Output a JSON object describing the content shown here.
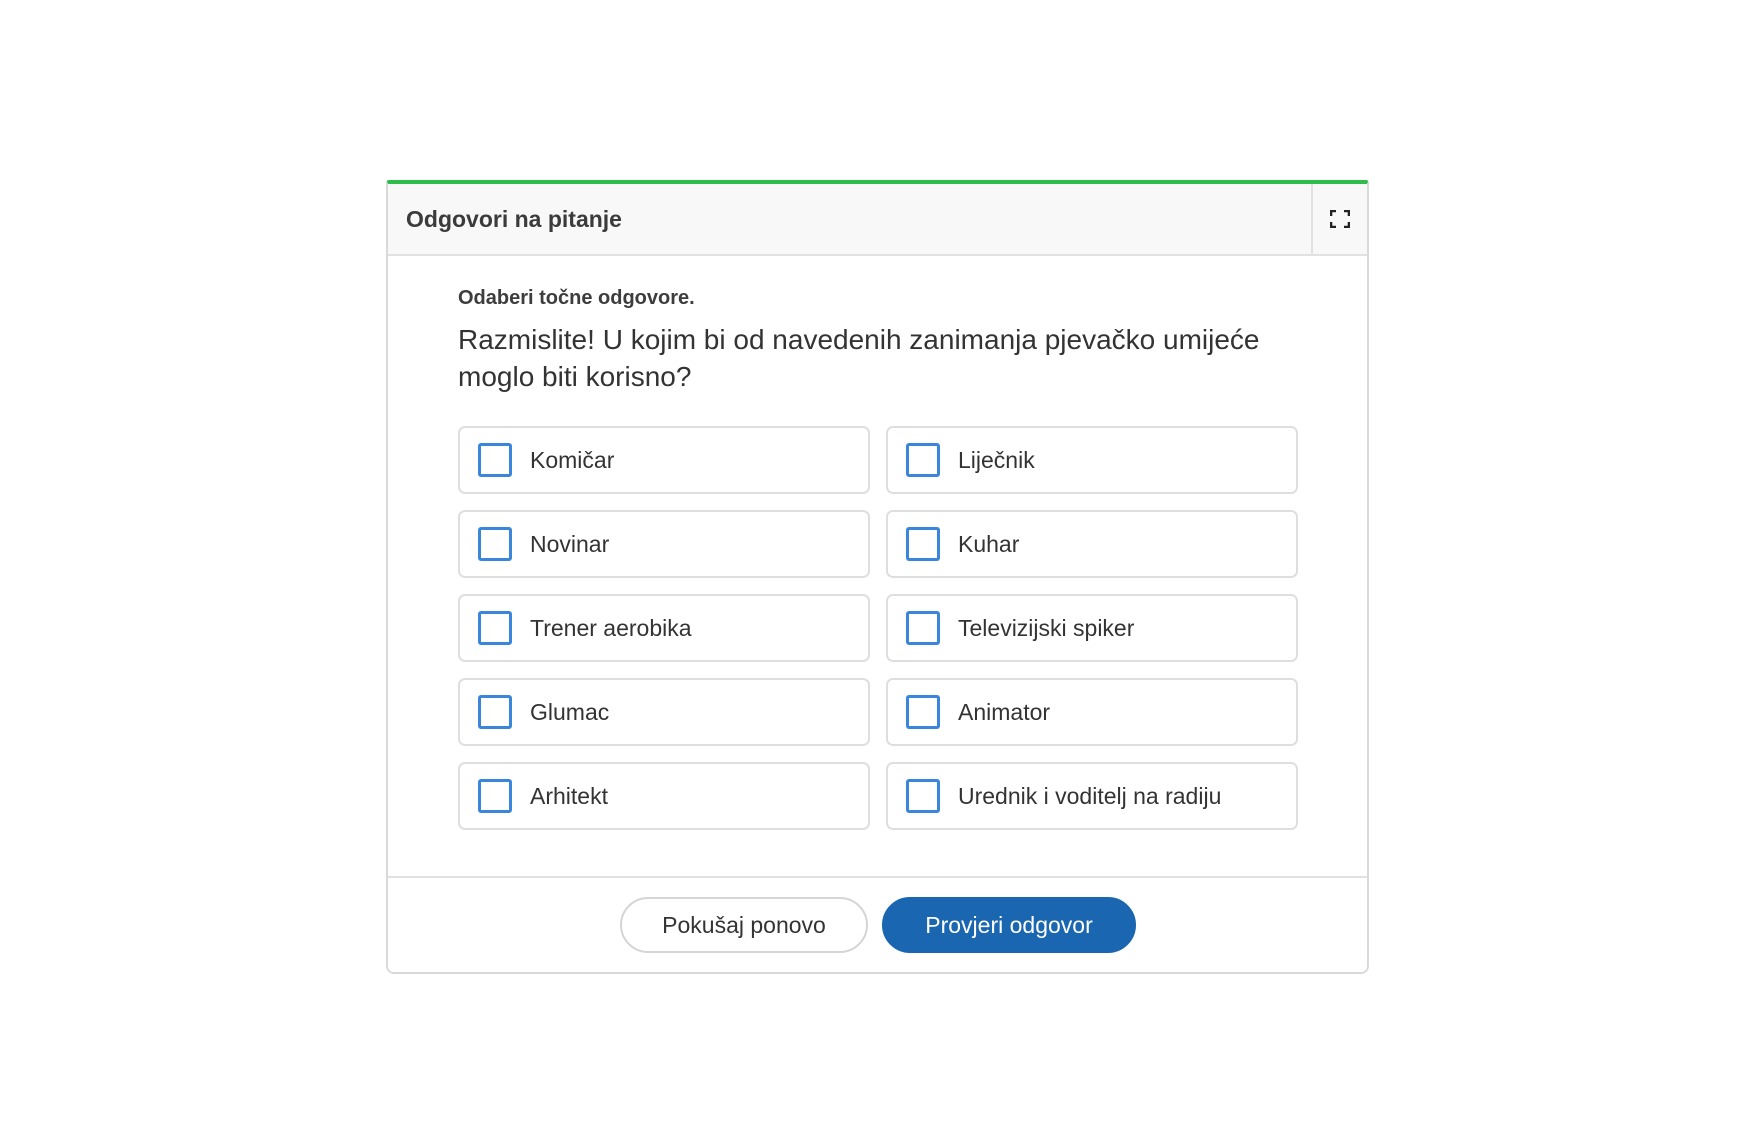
{
  "header": {
    "title": "Odgovori na pitanje",
    "fullscreen_icon": "fullscreen-icon"
  },
  "task": {
    "instruction": "Odaberi točne odgovore.",
    "question": "Razmislite! U kojim bi od navedenih zanimanja pjevačko umijeće moglo biti korisno?"
  },
  "options": [
    {
      "label": "Komičar",
      "checked": false
    },
    {
      "label": "Liječnik",
      "checked": false
    },
    {
      "label": "Novinar",
      "checked": false
    },
    {
      "label": "Kuhar",
      "checked": false
    },
    {
      "label": "Trener aerobika",
      "checked": false
    },
    {
      "label": "Televizijski spiker",
      "checked": false
    },
    {
      "label": "Glumac",
      "checked": false
    },
    {
      "label": "Animator",
      "checked": false
    },
    {
      "label": "Arhitekt",
      "checked": false
    },
    {
      "label": "Urednik i voditelj na radiju",
      "checked": false
    }
  ],
  "footer": {
    "retry_label": "Pokušaj ponovo",
    "check_label": "Provjeri odgovor"
  },
  "colors": {
    "accent_top_border": "#2ebd4a",
    "checkbox_border": "#3a86da",
    "primary_button": "#1a66b0"
  }
}
